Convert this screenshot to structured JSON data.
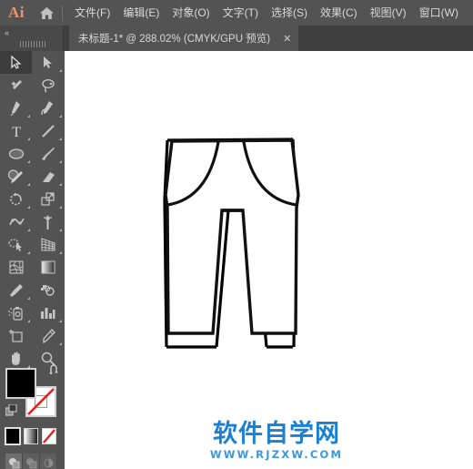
{
  "app": {
    "logo_text": "Ai",
    "logo_color": "#e8956b",
    "home_icon": "home-icon"
  },
  "menubar": {
    "items": [
      {
        "label": "文件(F)",
        "name": "menu-file"
      },
      {
        "label": "编辑(E)",
        "name": "menu-edit"
      },
      {
        "label": "对象(O)",
        "name": "menu-object"
      },
      {
        "label": "文字(T)",
        "name": "menu-type"
      },
      {
        "label": "选择(S)",
        "name": "menu-select"
      },
      {
        "label": "效果(C)",
        "name": "menu-effect"
      },
      {
        "label": "视图(V)",
        "name": "menu-view"
      },
      {
        "label": "窗口(W)",
        "name": "menu-window"
      }
    ]
  },
  "tabbar": {
    "collapse_label": "«",
    "document_tab": {
      "title": "未标题-1* @ 288.02% (CMYK/GPU 预览)",
      "close_label": "✕",
      "zoom_level": "288.02%",
      "color_mode": "CMYK",
      "render_mode": "GPU 预览"
    }
  },
  "toolbar": {
    "tools": [
      {
        "name": "selection-tool",
        "active": true,
        "has_flyout": false
      },
      {
        "name": "direct-selection-tool",
        "active": false,
        "has_flyout": true
      },
      {
        "name": "magic-wand-tool",
        "active": false,
        "has_flyout": false
      },
      {
        "name": "lasso-tool",
        "active": false,
        "has_flyout": false
      },
      {
        "name": "pen-tool",
        "active": false,
        "has_flyout": true
      },
      {
        "name": "curvature-tool",
        "active": false,
        "has_flyout": false
      },
      {
        "name": "type-tool",
        "active": false,
        "has_flyout": true
      },
      {
        "name": "line-segment-tool",
        "active": false,
        "has_flyout": true
      },
      {
        "name": "ellipse-tool",
        "active": false,
        "has_flyout": true
      },
      {
        "name": "paintbrush-tool",
        "active": false,
        "has_flyout": true
      },
      {
        "name": "shaper-tool",
        "active": false,
        "has_flyout": true
      },
      {
        "name": "eraser-tool",
        "active": false,
        "has_flyout": true
      },
      {
        "name": "rotate-tool",
        "active": false,
        "has_flyout": true
      },
      {
        "name": "scale-tool",
        "active": false,
        "has_flyout": true
      },
      {
        "name": "width-tool",
        "active": false,
        "has_flyout": true
      },
      {
        "name": "free-transform-tool",
        "active": false,
        "has_flyout": true
      },
      {
        "name": "shape-builder-tool",
        "active": false,
        "has_flyout": true
      },
      {
        "name": "perspective-grid-tool",
        "active": false,
        "has_flyout": true
      },
      {
        "name": "mesh-tool",
        "active": false,
        "has_flyout": false
      },
      {
        "name": "gradient-tool",
        "active": false,
        "has_flyout": false
      },
      {
        "name": "eyedropper-tool",
        "active": false,
        "has_flyout": true
      },
      {
        "name": "blend-tool",
        "active": false,
        "has_flyout": false
      },
      {
        "name": "symbol-sprayer-tool",
        "active": false,
        "has_flyout": true
      },
      {
        "name": "column-graph-tool",
        "active": false,
        "has_flyout": true
      },
      {
        "name": "artboard-tool",
        "active": false,
        "has_flyout": false
      },
      {
        "name": "slice-tool",
        "active": false,
        "has_flyout": true
      },
      {
        "name": "hand-tool",
        "active": false,
        "has_flyout": true
      },
      {
        "name": "zoom-tool",
        "active": false,
        "has_flyout": false
      }
    ],
    "fill_color": "#000000",
    "stroke_color": "#ffffff",
    "swap_icon": "swap-fill-stroke-icon",
    "default_icon": "default-fill-stroke-icon",
    "swatches": [
      {
        "name": "color-swatch",
        "selected": true
      },
      {
        "name": "gradient-swatch",
        "selected": false
      },
      {
        "name": "none-swatch",
        "selected": false
      }
    ],
    "draw_modes": [
      {
        "name": "draw-normal-mode",
        "active": true
      },
      {
        "name": "draw-behind-mode",
        "active": false
      },
      {
        "name": "draw-inside-mode",
        "active": false
      }
    ]
  },
  "canvas": {
    "background": "#ffffff",
    "artwork_name": "pants-outline-drawing"
  },
  "watermark": {
    "chinese": "软件自学网",
    "english": "WWW.RJZXW.COM",
    "color_cn": "#1b7fd4",
    "color_en": "#3b97e0"
  }
}
